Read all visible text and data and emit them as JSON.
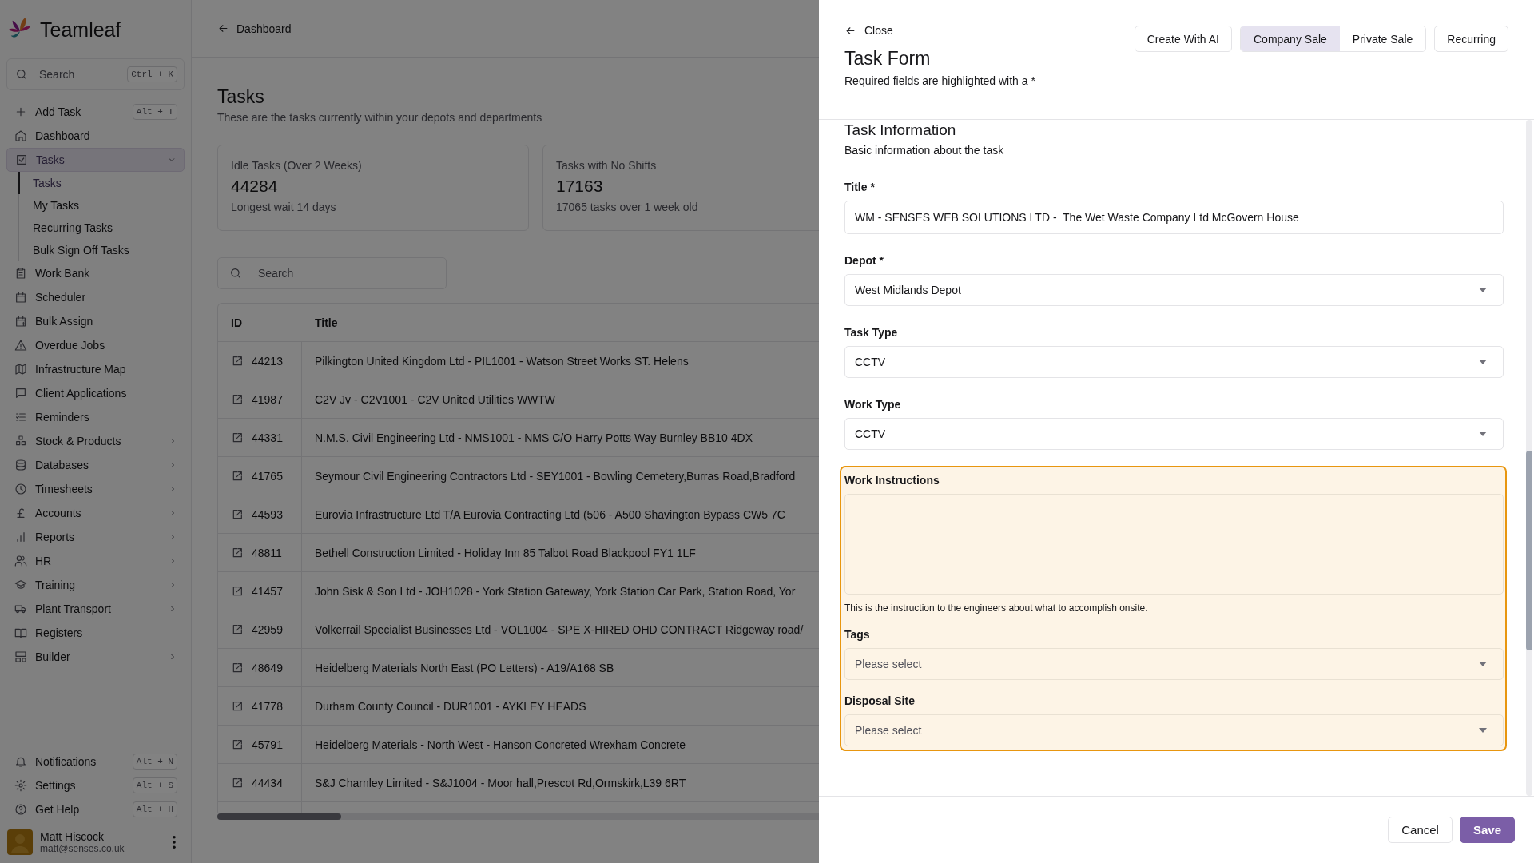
{
  "sidebar": {
    "brand": "Teamleaf",
    "search": {
      "placeholder": "Search",
      "shortcut": "Ctrl + K"
    },
    "items": [
      {
        "label": "Add Task",
        "shortcut": "Alt + T",
        "selected": false
      },
      {
        "label": "Dashboard",
        "selected": false
      },
      {
        "label": "Tasks",
        "selected": true,
        "expanded": true,
        "children": [
          {
            "label": "Tasks",
            "selected": true
          },
          {
            "label": "My Tasks",
            "selected": false
          },
          {
            "label": "Recurring Tasks",
            "selected": false
          },
          {
            "label": "Bulk Sign Off Tasks",
            "selected": false
          }
        ]
      },
      {
        "label": "Work Bank",
        "selected": false
      },
      {
        "label": "Scheduler",
        "selected": false
      },
      {
        "label": "Bulk Assign",
        "selected": false
      },
      {
        "label": "Overdue Jobs",
        "selected": false
      },
      {
        "label": "Infrastructure Map",
        "selected": false
      },
      {
        "label": "Client Applications",
        "selected": false
      },
      {
        "label": "Reminders",
        "selected": false
      },
      {
        "label": "Stock & Products",
        "selected": false,
        "expanded": false
      },
      {
        "label": "Databases",
        "selected": false,
        "expanded": false
      },
      {
        "label": "Timesheets",
        "selected": false,
        "expanded": false
      },
      {
        "label": "Accounts",
        "selected": false,
        "expanded": false
      },
      {
        "label": "Reports",
        "selected": false,
        "expanded": false
      },
      {
        "label": "HR",
        "selected": false,
        "expanded": false
      },
      {
        "label": "Training",
        "selected": false,
        "expanded": false
      },
      {
        "label": "Plant Transport",
        "selected": false,
        "expanded": false
      },
      {
        "label": "Registers",
        "selected": false
      },
      {
        "label": "Builder",
        "selected": false,
        "expanded": false
      }
    ],
    "footer_items": [
      {
        "label": "Notifications",
        "shortcut": "Alt + N"
      },
      {
        "label": "Settings",
        "shortcut": "Alt + S"
      },
      {
        "label": "Get Help",
        "shortcut": "Alt + H"
      }
    ],
    "user": {
      "name": "Matt Hiscock",
      "email": "matt@senses.co.uk"
    }
  },
  "main": {
    "back_link": "Dashboard",
    "title": "Tasks",
    "subtitle": "These are the tasks currently within your depots and departments",
    "stats": [
      {
        "label": "Idle Tasks (Over 2 Weeks)",
        "value": "44284",
        "note": "Longest wait 14 days"
      },
      {
        "label": "Tasks with No Shifts",
        "value": "17163",
        "note": "17065 tasks over 1 week old"
      }
    ],
    "search": {
      "placeholder": "Search"
    },
    "table": {
      "columns": [
        "ID",
        "Title"
      ],
      "rows": [
        {
          "id": "44213",
          "title": "Pilkington United Kingdom Ltd - PIL1001 - Watson Street Works ST. Helens"
        },
        {
          "id": "41987",
          "title": "C2V Jv - C2V1001 - C2V United Utilities WWTW"
        },
        {
          "id": "44331",
          "title": "N.M.S. Civil Engineering Ltd - NMS1001 - NMS C/O Harry Potts Way Burnley BB10 4DX"
        },
        {
          "id": "41765",
          "title": "Seymour Civil Engineering Contractors Ltd - SEY1001 - Bowling Cemetery,Burras Road,Bradford"
        },
        {
          "id": "44593",
          "title": "Eurovia Infrastructure Ltd T/A Eurovia Contracting Ltd (506 - A500 Shavington Bypass CW5 7C"
        },
        {
          "id": "48811",
          "title": "Bethell Construction Limited - Holiday Inn 85 Talbot Road Blackpool FY1 1LF"
        },
        {
          "id": "41457",
          "title": "John Sisk & Son Ltd - JOH1028 - York Station Gateway, York Station Car Park, Station Road, Yor"
        },
        {
          "id": "42959",
          "title": "Volkerrail Specialist Businesses Ltd - VOL1004 - SPE X-HIRED OHD CONTRACT Ridgeway road/"
        },
        {
          "id": "48649",
          "title": "Heidelberg Materials North East (PO Letters) - A19/A168 SB"
        },
        {
          "id": "41778",
          "title": "Durham County Council - DUR1001 - AYKLEY HEADS"
        },
        {
          "id": "45791",
          "title": "Heidelberg Materials - North West - Hanson Concreted Wrexham Concrete"
        },
        {
          "id": "44434",
          "title": "S&J Charnley Limited - S&J1004 - Moor hall,Prescot Rd,Ormskirk,L39 6RT"
        }
      ]
    }
  },
  "panel": {
    "close": "Close",
    "title": "Task Form",
    "subtitle": "Required fields are highlighted with a *",
    "ai_button": "Create With AI",
    "modes": [
      {
        "label": "Company Sale",
        "selected": true
      },
      {
        "label": "Private Sale",
        "selected": false
      }
    ],
    "recurring_button": "Recurring",
    "section": {
      "title": "Task Information",
      "description": "Basic information about the task"
    },
    "fields": [
      {
        "kind": "text",
        "label": "Title *",
        "value": "WM - SENSES WEB SOLUTIONS LTD -  The Wet Waste Company Ltd McGovern House"
      },
      {
        "kind": "select",
        "label": "Depot *",
        "value": "West Midlands Depot"
      },
      {
        "kind": "select",
        "label": "Task Type",
        "value": "CCTV"
      },
      {
        "kind": "select",
        "label": "Work Type",
        "value": "CCTV"
      }
    ],
    "highlighted_fields": [
      {
        "kind": "textarea",
        "label": "Work Instructions",
        "help": "This is the instruction to the engineers about what to accomplish onsite."
      },
      {
        "kind": "select",
        "label": "Tags",
        "placeholder": "Please select"
      },
      {
        "kind": "select",
        "label": "Disposal Site",
        "placeholder": "Please select"
      }
    ],
    "footer_buttons": [
      {
        "label": "Cancel",
        "kind": "secondary"
      },
      {
        "label": "Save",
        "kind": "primary"
      }
    ]
  }
}
